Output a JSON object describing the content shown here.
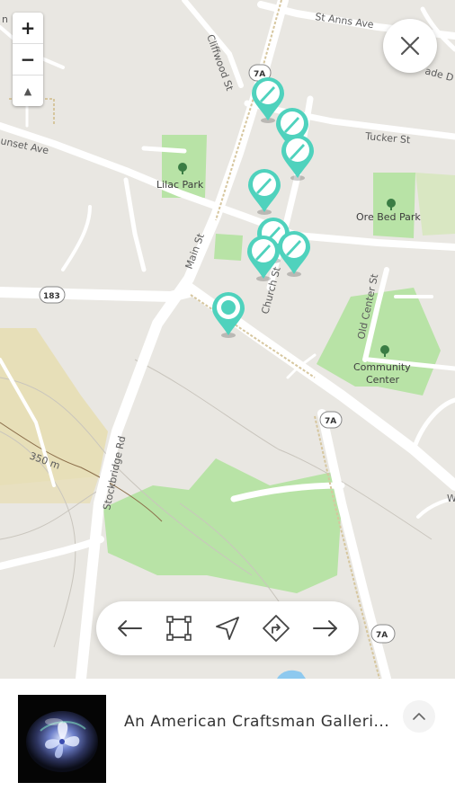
{
  "map": {
    "roads": {
      "st_anns_ave": "St Anns Ave",
      "cliffwood_st": "Cliffwood St",
      "tucker_st": "Tucker St",
      "sunset_ave": "unset Ave",
      "main_st": "Main St",
      "church_st": "Church St",
      "old_center_st": "Old Center St",
      "stockbridge_rd": "Stockbridge Rd",
      "east_partial": "ade D",
      "west_partial": "W",
      "north_partial": "n"
    },
    "parks": {
      "lilac": "Lilac Park",
      "ore_bed": "Ore Bed Park",
      "community_center_1": "Community",
      "community_center_2": "Center"
    },
    "shields": [
      "7A",
      "183",
      "7A",
      "7A"
    ],
    "elevation": "350 m"
  },
  "controls": {
    "zoom_in": "+",
    "zoom_out": "−",
    "compass": "▲"
  },
  "markers": [
    {
      "icon": "knife-icon"
    },
    {
      "icon": "knife-icon"
    },
    {
      "icon": "knife-icon"
    },
    {
      "icon": "knife-icon"
    },
    {
      "icon": "knife-icon"
    },
    {
      "icon": "knife-icon"
    },
    {
      "icon": "knife-icon"
    },
    {
      "icon": "location-dot-icon"
    }
  ],
  "toolbar": {
    "icons": [
      "arrow-left-icon",
      "select-area-icon",
      "navigate-icon",
      "directions-icon",
      "arrow-right-icon"
    ]
  },
  "bottom_sheet": {
    "title": "An American Craftsman Galleri..."
  },
  "colors": {
    "marker": "#4fd2bd",
    "park": "#b8e3a6",
    "road": "#ffffff",
    "land": "#e9e7e2"
  }
}
